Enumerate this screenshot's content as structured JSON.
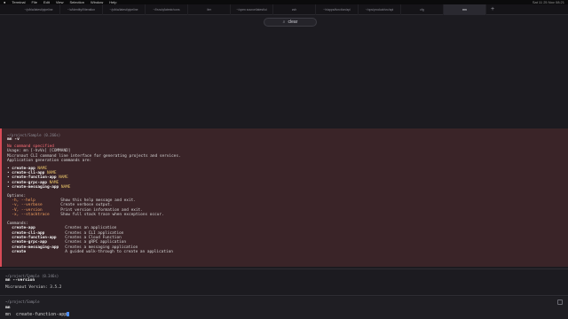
{
  "menubar": {
    "items": [
      "Terminal",
      "File",
      "Edit",
      "View",
      "Selection",
      "Window",
      "Help"
    ],
    "status": "Sat 11 25 Nov 08:21"
  },
  "tabs": [
    "~/p/bla/latest/pipeline",
    "~/c/identity/f/iteration",
    "~/p/bla/latest/pipeline",
    "~/l/src/q/latestr/cons",
    "iter",
    "~/open source/latest/ui",
    "zsh",
    "~/r/apps/function/api",
    "~/ops/product/src/api",
    "cfg",
    "mn"
  ],
  "active_tab_index": 10,
  "search": {
    "query": "clear"
  },
  "error_block": {
    "path": "~/project/Sample (0.266s)",
    "command": "mn -v",
    "lines": [
      "No command specified",
      "Usage: mn [-hvVx] [COMMAND]",
      "Micronaut CLI command line interface for generating projects and services.",
      "Application generation commands are:"
    ],
    "gen_commands": [
      {
        "cmd": "create-app",
        "arg": "NAME"
      },
      {
        "cmd": "create-cli-app",
        "arg": "NAME"
      },
      {
        "cmd": "create-function-app",
        "arg": "NAME"
      },
      {
        "cmd": "create-grpc-app",
        "arg": "NAME"
      },
      {
        "cmd": "create-messaging-app",
        "arg": "NAME"
      }
    ],
    "options_header": "Options:",
    "options": [
      {
        "flag": "-h, --help",
        "desc": "Show this help message and exit."
      },
      {
        "flag": "-v, --verbose",
        "desc": "Create verbose output."
      },
      {
        "flag": "-V, --version",
        "desc": "Print version information and exit."
      },
      {
        "flag": "-x, --stacktrace",
        "desc": "Show full stack trace when exceptions occur."
      }
    ],
    "commands_header": "Commands:",
    "commands": [
      {
        "cmd": "create-app",
        "desc": "Creates an application"
      },
      {
        "cmd": "create-cli-app",
        "desc": "Creates a CLI application"
      },
      {
        "cmd": "create-function-app",
        "desc": "Creates a Cloud Function"
      },
      {
        "cmd": "create-grpc-app",
        "desc": "Creates a gRPC application"
      },
      {
        "cmd": "create-messaging-app",
        "desc": "Creates a messaging application"
      },
      {
        "cmd": "create",
        "desc": "A guided walk-through to create an application"
      }
    ]
  },
  "version_block": {
    "path": "~/project/Sample (0.346s)",
    "command": "mn --version",
    "output": "Micronaut Version: 3.5.2"
  },
  "prompt": {
    "path": "~/project/Sample",
    "command": "mn",
    "input": "mn  create-function-app"
  },
  "colors": {
    "error_bg": "#3a2428",
    "error_accent": "#d94b57",
    "arg": "#e9c46a",
    "caret": "#4c8cff"
  }
}
